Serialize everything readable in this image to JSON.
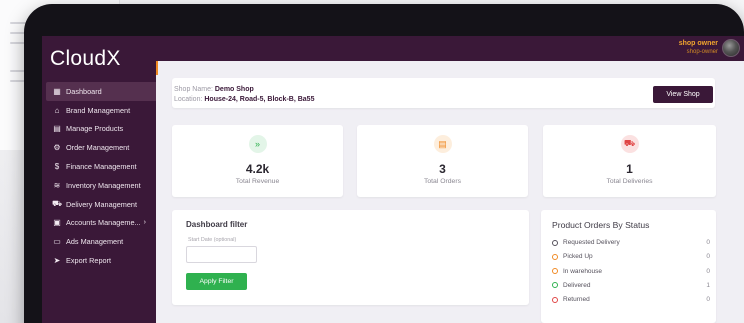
{
  "app": {
    "name": "CloudX"
  },
  "user": {
    "name": "shop owner",
    "role": "shop-owner"
  },
  "sidebar": {
    "items": [
      {
        "label": "Dashboard",
        "icon": "grid-icon",
        "glyph": "▦",
        "active": true
      },
      {
        "label": "Brand Management",
        "icon": "store-icon",
        "glyph": "⌂"
      },
      {
        "label": "Manage Products",
        "icon": "gift-icon",
        "glyph": "▤"
      },
      {
        "label": "Order Management",
        "icon": "gear-icon",
        "glyph": "⚙"
      },
      {
        "label": "Finance Management",
        "icon": "dollar-icon",
        "glyph": "$"
      },
      {
        "label": "Inventory Management",
        "icon": "layers-icon",
        "glyph": "≋"
      },
      {
        "label": "Delivery Management",
        "icon": "truck-icon",
        "glyph": "⛟"
      },
      {
        "label": "Accounts Manageme...",
        "icon": "book-icon",
        "glyph": "▣",
        "has_submenu": true
      },
      {
        "label": "Ads Management",
        "icon": "monitor-icon",
        "glyph": "▭"
      },
      {
        "label": "Export Report",
        "icon": "send-icon",
        "glyph": "➤"
      }
    ]
  },
  "shop": {
    "name_label": "Shop Name:",
    "name": "Demo Shop",
    "location_label": "Location:",
    "location": "House-24, Road-5, Block-B, Ba55",
    "view_button": "View Shop"
  },
  "stats": [
    {
      "value": "4.2k",
      "label": "Total Revenue",
      "icon": "chevrons-down-icon",
      "glyph": "»",
      "color": "#2fb14f",
      "bg": "#e3f5e8"
    },
    {
      "value": "3",
      "label": "Total Orders",
      "icon": "clipboard-icon",
      "glyph": "▤",
      "color": "#f08a24",
      "bg": "#fdeedd"
    },
    {
      "value": "1",
      "label": "Total Deliveries",
      "icon": "truck-icon",
      "glyph": "⛟",
      "color": "#e04545",
      "bg": "#fbe1e1"
    }
  ],
  "filter": {
    "title": "Dashboard filter",
    "start_label": "Start Date (optional)",
    "apply_button": "Apply Filter"
  },
  "status": {
    "title": "Product Orders By Status",
    "rows": [
      {
        "label": "Requested Delivery",
        "count": "0",
        "color": "#55515c"
      },
      {
        "label": "Picked Up",
        "count": "0",
        "color": "#f08a24"
      },
      {
        "label": "In warehouse",
        "count": "0",
        "color": "#f08a24"
      },
      {
        "label": "Delivered",
        "count": "1",
        "color": "#2fb14f"
      },
      {
        "label": "Returned",
        "count": "0",
        "color": "#e04545"
      }
    ]
  },
  "colors": {
    "brand": "#3a1838",
    "accent": "#f08a24",
    "success": "#2fb14f"
  }
}
